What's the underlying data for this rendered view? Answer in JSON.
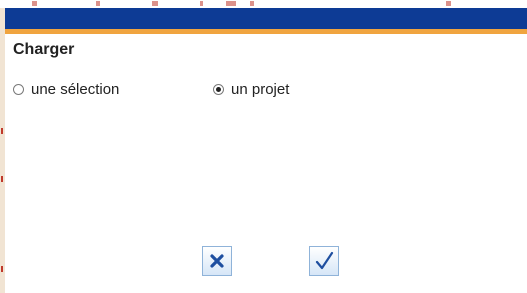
{
  "dialog": {
    "title": "Charger",
    "options": [
      {
        "label": "une sélection",
        "selected": false
      },
      {
        "label": "un projet",
        "selected": true
      }
    ],
    "buttons": {
      "cancel_icon": "close-icon",
      "confirm_icon": "checkmark-icon"
    }
  },
  "colors": {
    "title_bar": "#0d3b95",
    "title_bar_border": "#f0a43f",
    "icon_blue": "#1f4fa0"
  }
}
